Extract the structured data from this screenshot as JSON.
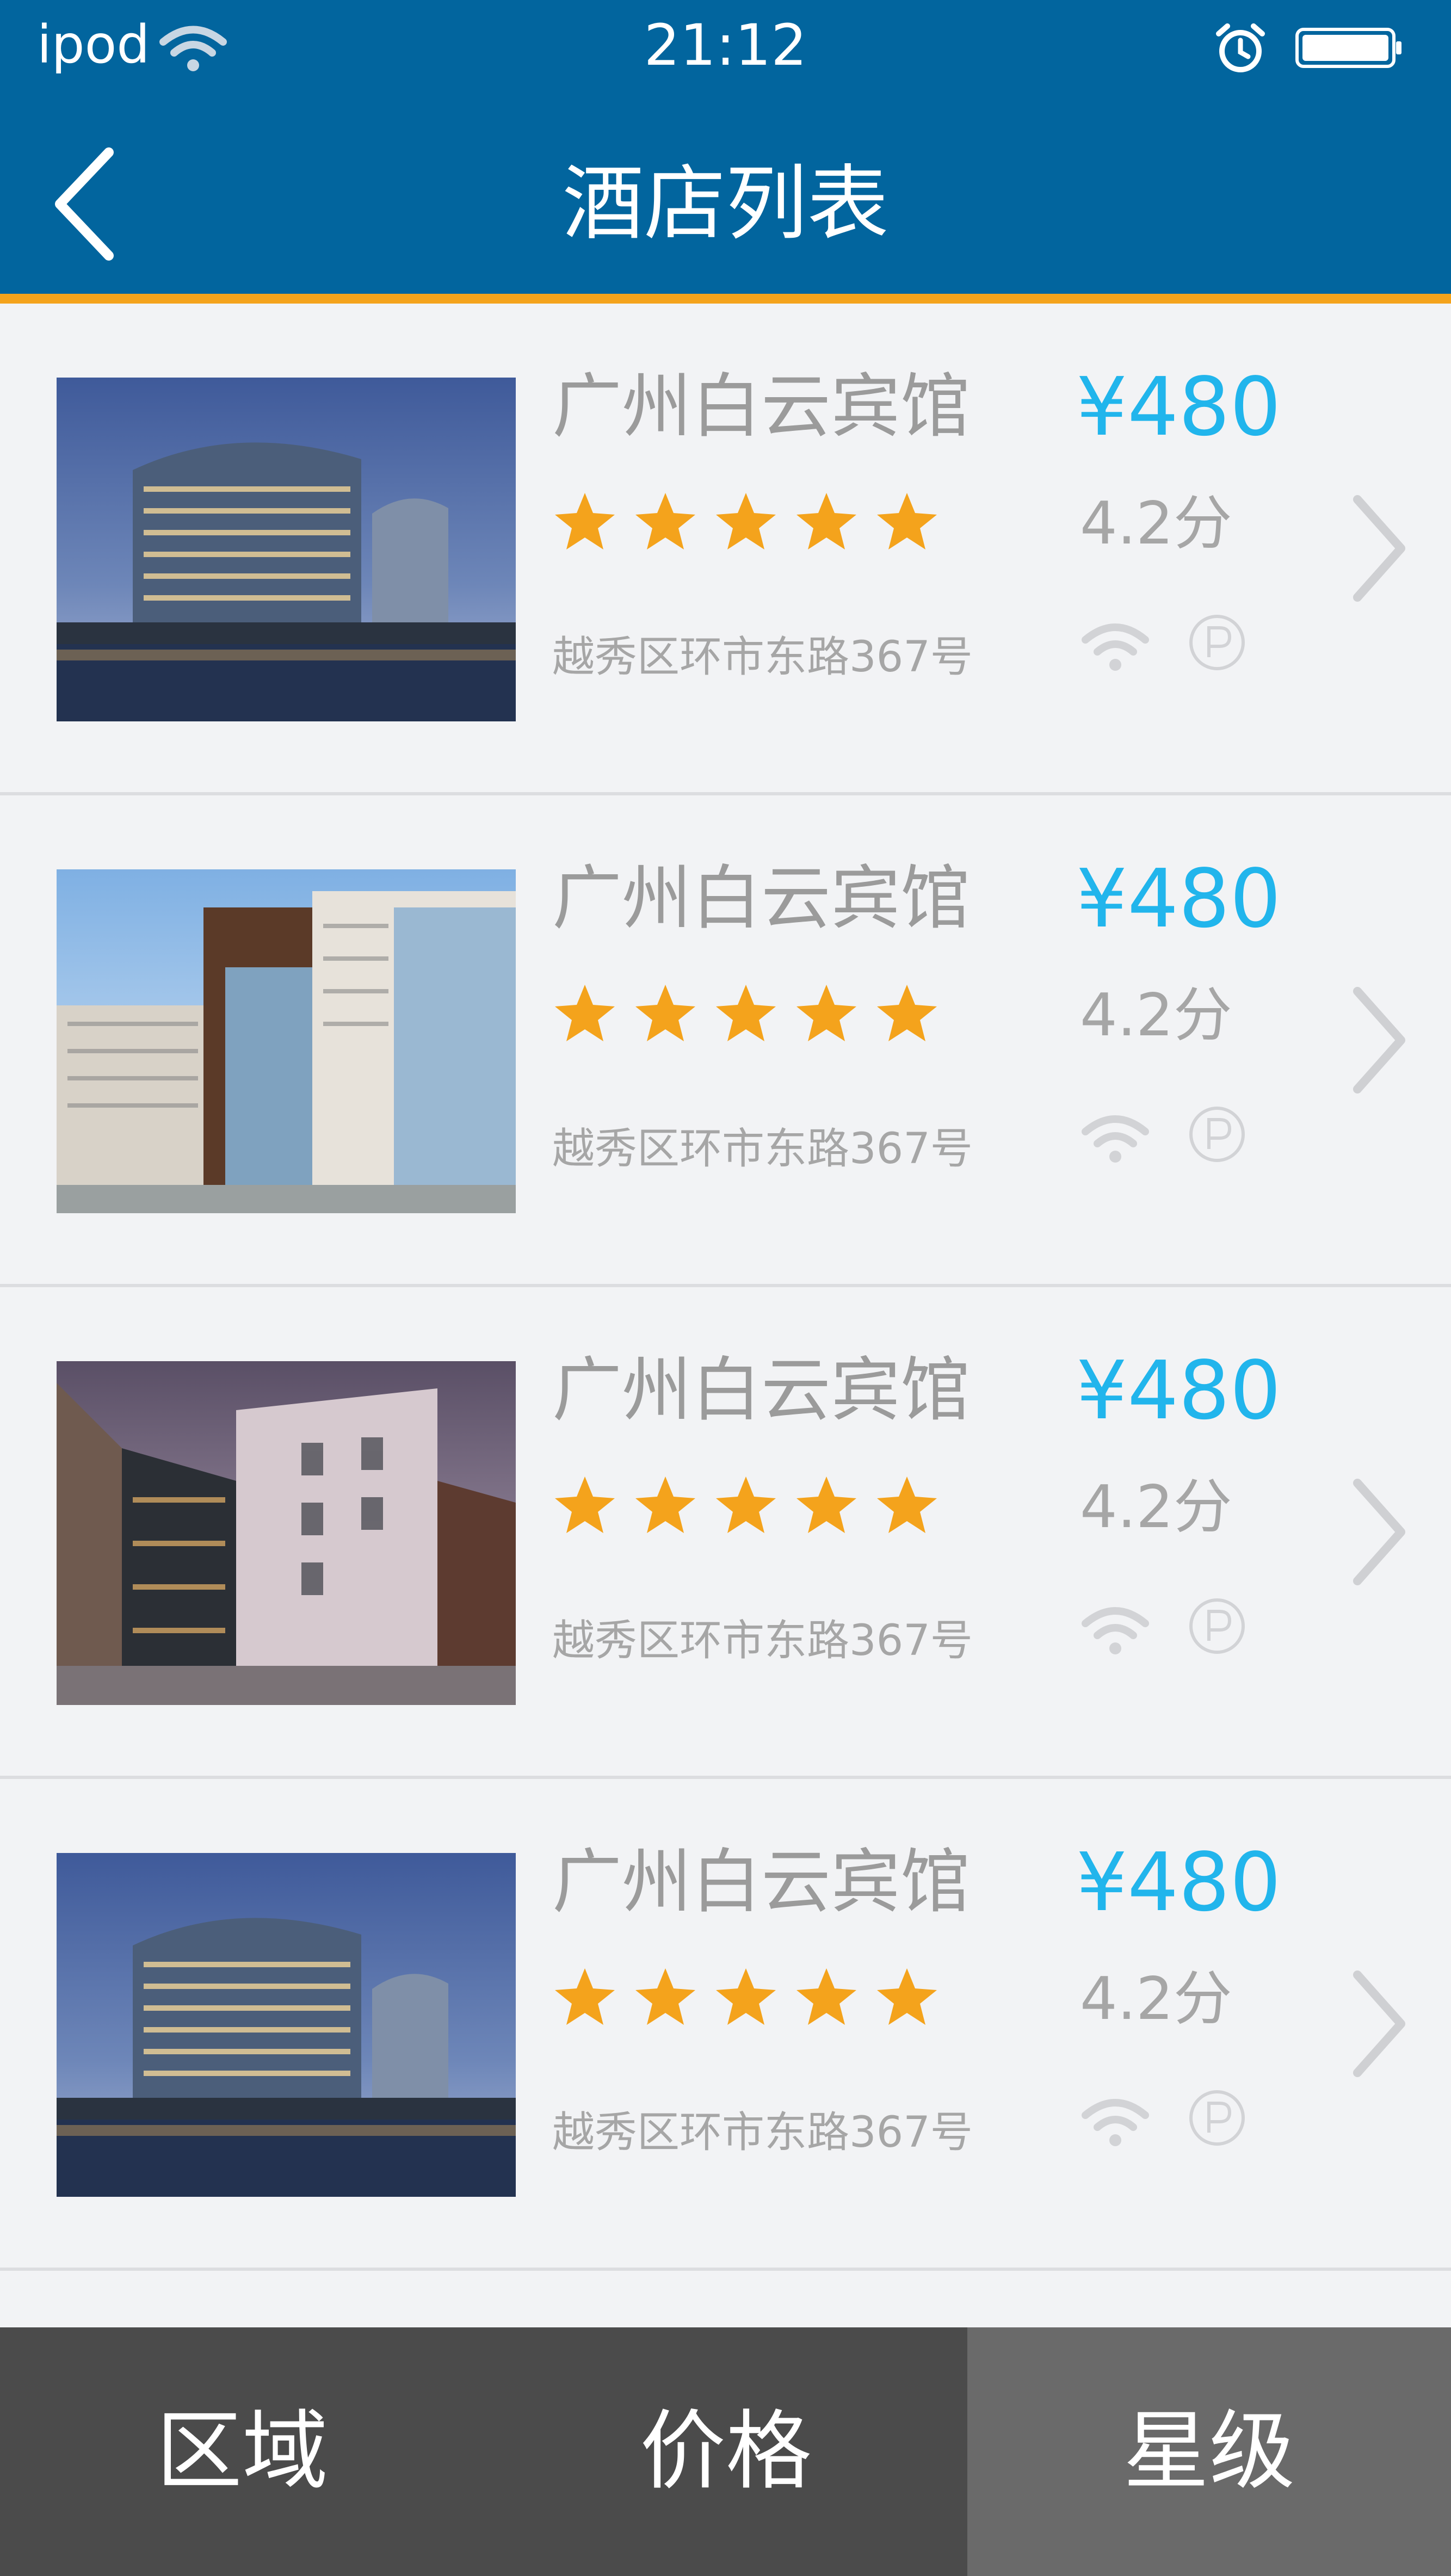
{
  "status_bar": {
    "carrier": "ipod",
    "time": "21:12",
    "icons": [
      "wifi-icon",
      "alarm-icon",
      "battery-icon"
    ]
  },
  "nav": {
    "title": "酒店列表",
    "back_icon": "chevron-left-icon"
  },
  "colors": {
    "header": "#02659e",
    "accent": "#f4a31c",
    "price": "#21b5ec",
    "star": "#f4a31c",
    "tab_bar": "#4b4b4b",
    "tab_selected": "#6a6a6a"
  },
  "hotels": [
    {
      "name": "广州白云宾馆",
      "price": "¥480",
      "rating": "4.2分",
      "stars": 5,
      "address": "越秀区环市东路367号",
      "amenities": [
        "wifi-icon",
        "parking-icon"
      ]
    },
    {
      "name": "广州白云宾馆",
      "price": "¥480",
      "rating": "4.2分",
      "stars": 5,
      "address": "越秀区环市东路367号",
      "amenities": [
        "wifi-icon",
        "parking-icon"
      ]
    },
    {
      "name": "广州白云宾馆",
      "price": "¥480",
      "rating": "4.2分",
      "stars": 5,
      "address": "越秀区环市东路367号",
      "amenities": [
        "wifi-icon",
        "parking-icon"
      ]
    },
    {
      "name": "广州白云宾馆",
      "price": "¥480",
      "rating": "4.2分",
      "stars": 5,
      "address": "越秀区环市东路367号",
      "amenities": [
        "wifi-icon",
        "parking-icon"
      ]
    }
  ],
  "tabs": [
    {
      "label": "区域",
      "selected": false
    },
    {
      "label": "价格",
      "selected": false
    },
    {
      "label": "星级",
      "selected": true
    }
  ]
}
